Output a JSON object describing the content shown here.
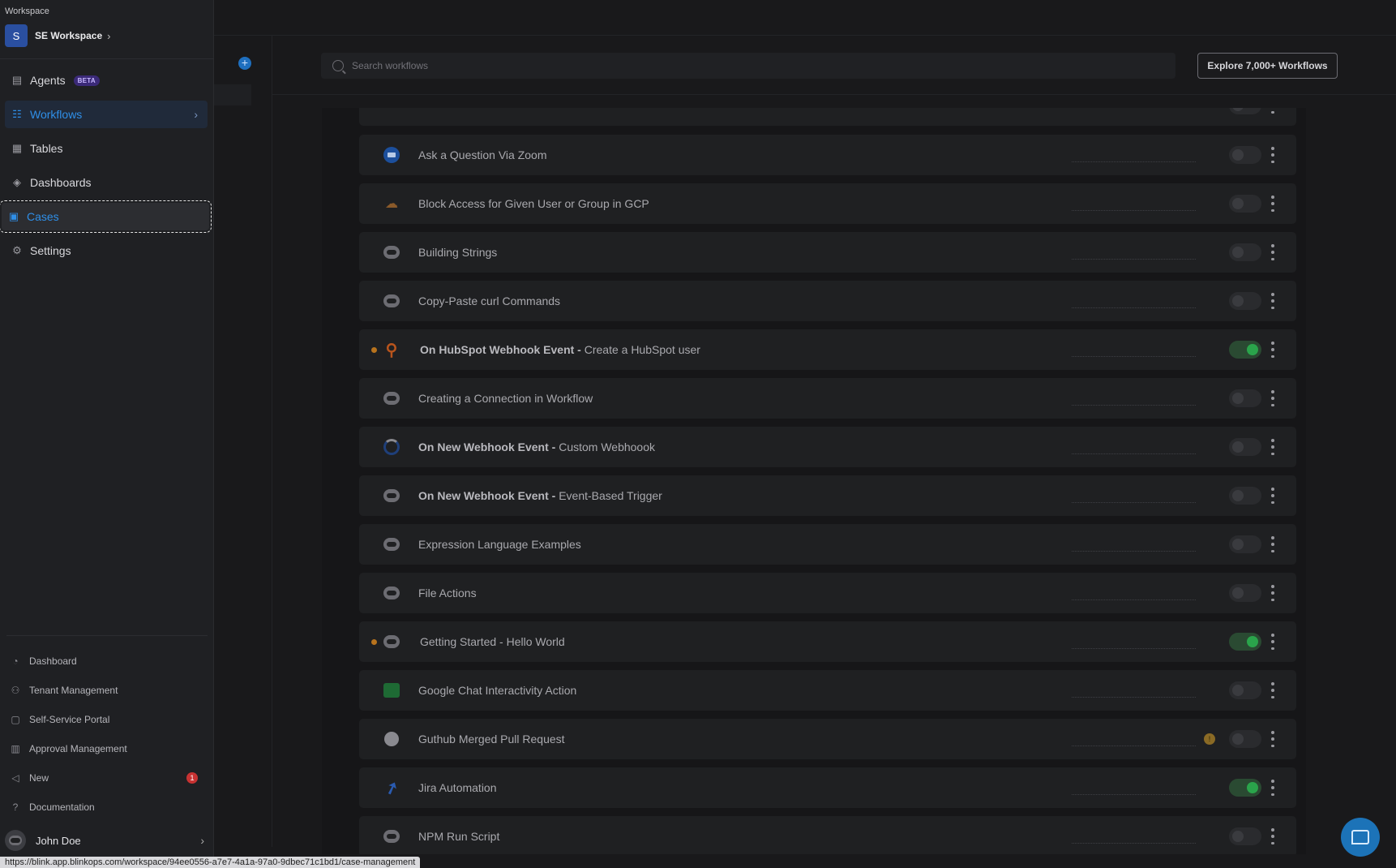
{
  "workspace": {
    "label": "Workspace",
    "avatar_letter": "S",
    "name": "SE Workspace",
    "chevron": "chevron-right-icon"
  },
  "sidebar": {
    "items": [
      {
        "label": "Agents",
        "icon": "agents-icon",
        "badge": "BETA"
      },
      {
        "label": "Workflows",
        "icon": "workflows-icon",
        "active": true
      },
      {
        "label": "Tables",
        "icon": "table-icon"
      },
      {
        "label": "Dashboards",
        "icon": "layers-icon"
      },
      {
        "label": "Cases",
        "icon": "clipboard-icon",
        "focused": true
      },
      {
        "label": "Settings",
        "icon": "gear-icon"
      }
    ],
    "bottom_items": [
      {
        "label": "Dashboard",
        "icon": "pie-icon"
      },
      {
        "label": "Tenant Management",
        "icon": "users-gear-icon"
      },
      {
        "label": "Self-Service Portal",
        "icon": "portal-icon"
      },
      {
        "label": "Approval Management",
        "icon": "approval-icon"
      },
      {
        "label": "New",
        "icon": "megaphone-icon",
        "badge": "1"
      },
      {
        "label": "Documentation",
        "icon": "help-icon"
      }
    ],
    "user": {
      "name": "John Doe"
    }
  },
  "toolbar": {
    "search_placeholder": "Search workflows",
    "explore_label": "Explore 7,000+ Workflows",
    "add_label": "+"
  },
  "workflows": [
    {
      "trigger": "",
      "name": "Ask a Question Via Zoom",
      "icon": "zoom-icon",
      "enabled": false
    },
    {
      "trigger": "",
      "name": "Block Access for Given User or Group in GCP",
      "icon": "gcp-icon",
      "enabled": false
    },
    {
      "trigger": "",
      "name": "Building Strings",
      "icon": "bot-icon",
      "enabled": false
    },
    {
      "trigger": "",
      "name": "Copy-Paste curl Commands",
      "icon": "bot-icon",
      "enabled": false
    },
    {
      "trigger": "On HubSpot Webhook Event - ",
      "name": "Create a HubSpot user",
      "icon": "hubspot-icon",
      "enabled": true,
      "dot": true
    },
    {
      "trigger": "",
      "name": "Creating a Connection in Workflow",
      "icon": "bot-icon",
      "enabled": false
    },
    {
      "trigger": "On New Webhook Event - ",
      "name": "Custom Webhoook",
      "icon": "webhook-icon",
      "enabled": false
    },
    {
      "trigger": "On New Webhook Event - ",
      "name": "Event-Based Trigger",
      "icon": "bot-icon",
      "enabled": false
    },
    {
      "trigger": "",
      "name": "Expression Language Examples",
      "icon": "bot-icon",
      "enabled": false
    },
    {
      "trigger": "",
      "name": "File Actions",
      "icon": "bot-icon",
      "enabled": false
    },
    {
      "trigger": "",
      "name": "Getting Started - Hello World",
      "icon": "bot-icon",
      "enabled": true,
      "dot": true
    },
    {
      "trigger": "",
      "name": "Google Chat Interactivity Action",
      "icon": "google-chat-icon",
      "enabled": false
    },
    {
      "trigger": "",
      "name": "Guthub Merged Pull Request",
      "icon": "github-icon",
      "enabled": false,
      "warning": "!"
    },
    {
      "trigger": "",
      "name": "Jira Automation",
      "icon": "jira-icon",
      "enabled": true
    },
    {
      "trigger": "",
      "name": "NPM Run Script",
      "icon": "bot-icon",
      "enabled": false
    }
  ],
  "status_url": "https://blink.app.blinkops.com/workspace/94ee0556-a7e7-4a1a-97a0-9dbec71c1bd1/case-management"
}
